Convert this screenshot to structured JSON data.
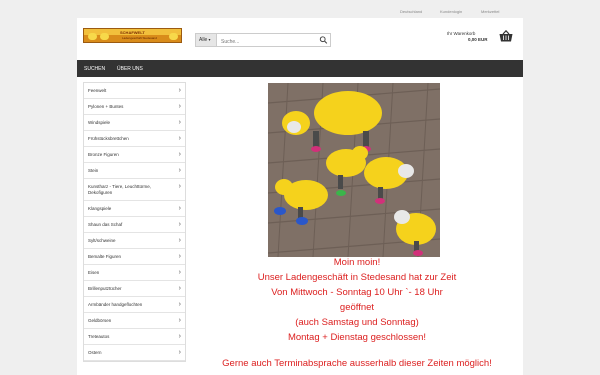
{
  "top_links": [
    "Deutschland",
    "Kundenlogin",
    "Merkzettel"
  ],
  "logo": {
    "text": "SCHAFWELT",
    "sub": "Ladengeschäft Stedesand"
  },
  "search": {
    "category": "Alle",
    "placeholder": "Suche..."
  },
  "cart": {
    "title": "Ihr Warenkorb",
    "total": "0,00 EUR"
  },
  "nav": [
    "SUCHEN",
    "ÜBER UNS"
  ],
  "categories": [
    "Feenwelt",
    "Pylonen + Buntes",
    "Windspiele",
    "Frühstücksbrettchen",
    "Bronze Figuren",
    "Stein",
    "Kunstharz - Tiere, Leuchttürme, Dekofiguren",
    "Klangspiele",
    "Shaun das Schaf",
    "Sylt/schweine",
    "Bemalte Figuren",
    "Eisen",
    "Brillenputztücher",
    "Armbänder handgeflochten",
    "Geldbörsen",
    "Treteautos",
    "Ostern"
  ],
  "message": [
    "Moin moin!",
    "Unser Ladengeschäft in Stedesand hat zur Zeit",
    "Von Mittwoch - Sonntag 10 Uhr `- 18 Uhr",
    "geöffnet",
    "(auch Samstag und Sonntag)",
    "Montag + Dienstag geschlossen!",
    "",
    "Gerne auch Terminabsprache ausserhalb dieser Zeiten möglich!"
  ],
  "colors": {
    "accent_red": "#dc1f1f",
    "navbar": "#333333",
    "sheep_yellow": "#f5d21c"
  }
}
